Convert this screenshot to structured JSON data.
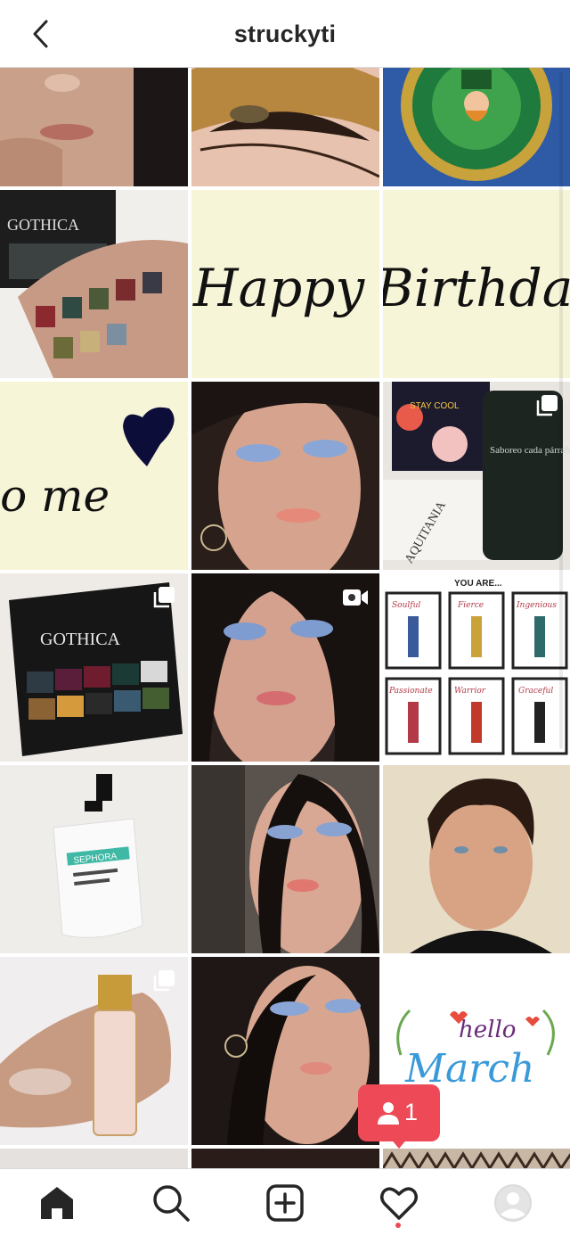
{
  "header": {
    "title": "struckyti",
    "back_icon": "chevron-left-icon"
  },
  "grid": {
    "tiles": [
      {
        "subject": "face close-up selfie"
      },
      {
        "subject": "gold eyeshadow eye close-up"
      },
      {
        "subject": "leprechaun enamel pin"
      },
      {
        "subject": "Gothica palette swatches on arm"
      },
      {
        "subject": "Happy Birthday text left"
      },
      {
        "subject": "Happy Birthday text right"
      },
      {
        "subject": "birthday to me with heart"
      },
      {
        "subject": "blue eyeshadow selfie"
      },
      {
        "subject": "books and travel mug"
      },
      {
        "subject": "Gothica eyeshadow palette"
      },
      {
        "subject": "blue eyeshadow selfie with earrings"
      },
      {
        "subject": "You are illustrated grid"
      },
      {
        "subject": "Sephora cleansing milk bottle"
      },
      {
        "subject": "blue eyeshadow selfie"
      },
      {
        "subject": "man portrait"
      },
      {
        "subject": "lip oil swatch on hand"
      },
      {
        "subject": "blue eyeshadow selfie"
      },
      {
        "subject": "hello March lettering"
      }
    ],
    "text": {
      "happy_left": "Happy",
      "birthday": "Birthday",
      "to_me": "to me",
      "gothica": "GOTHICA",
      "you_are": "YOU ARE...",
      "sephora": "SEPHORA",
      "stay_cool": "STAY COOL",
      "aquitania": "AQUITANIA",
      "mug_text": "Saboreo cada párrafo, soy Socio Leyenda",
      "hello": "hello",
      "march": "March",
      "poster_labels": [
        "Soulful",
        "Fierce",
        "Ingenious",
        "Passionate",
        "Warrior",
        "Graceful"
      ]
    },
    "badges": {
      "multi_icon": "carousel-icon",
      "video_icon": "video-camera-icon"
    }
  },
  "notification": {
    "count": "1",
    "icon": "person-icon"
  },
  "tabbar": {
    "items": [
      {
        "name": "home",
        "icon": "home-icon"
      },
      {
        "name": "search",
        "icon": "search-icon"
      },
      {
        "name": "new-post",
        "icon": "plus-square-icon"
      },
      {
        "name": "activity",
        "icon": "heart-icon"
      },
      {
        "name": "profile",
        "icon": "avatar-icon"
      }
    ]
  },
  "colors": {
    "accent": "#ed4956",
    "text": "#262626",
    "divider": "#dbdbdb"
  }
}
